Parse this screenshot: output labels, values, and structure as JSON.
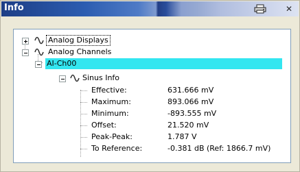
{
  "panel": {
    "title": "Info"
  },
  "tree": {
    "nodes": [
      {
        "label": "Analog Displays",
        "expander": "+",
        "icon": "sine-wave-icon"
      },
      {
        "label": "Analog Channels",
        "expander": "-",
        "icon": "sine-wave-icon"
      },
      {
        "label": "AI-Ch00",
        "expander": "-",
        "selected": true
      },
      {
        "label": "Sinus Info",
        "expander": "-",
        "icon": "sine-wave-icon"
      }
    ],
    "properties": [
      {
        "name": "Effective:",
        "value": "631.666 mV"
      },
      {
        "name": "Maximum:",
        "value": "893.066 mV"
      },
      {
        "name": "Minimum:",
        "value": "-893.555 mV"
      },
      {
        "name": "Offset:",
        "value": "21.520 mV"
      },
      {
        "name": "Peak-Peak:",
        "value": "1.787 V"
      },
      {
        "name": "To Reference:",
        "value": "-0.381 dB (Ref: 1866.7 mV)"
      }
    ]
  },
  "colors": {
    "selection": "#33e6f0",
    "titlebar": "#2c5cb0"
  }
}
